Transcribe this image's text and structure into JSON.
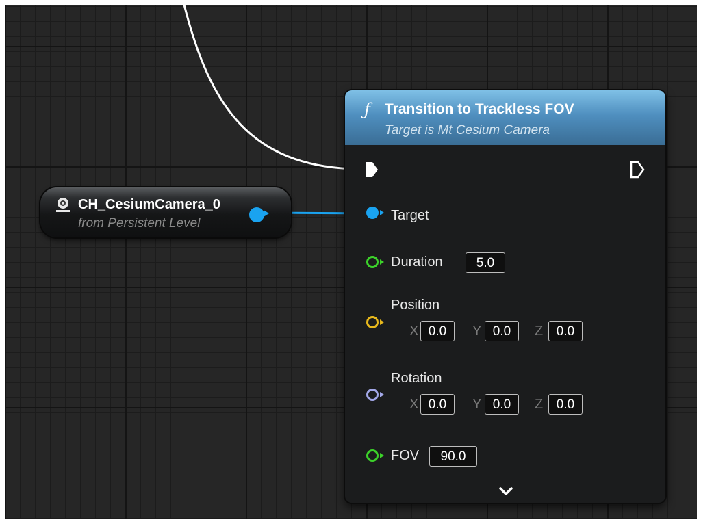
{
  "reference_node": {
    "name": "CH_CesiumCamera_0",
    "source": "from Persistent Level",
    "icon": "camera-actor-icon"
  },
  "function_node": {
    "icon_glyph": "ƒ",
    "title": "Transition to Trackless FOV",
    "subtitle": "Target is Mt Cesium Camera",
    "target_label": "Target",
    "duration": {
      "label": "Duration",
      "value": "5.0"
    },
    "position": {
      "label": "Position",
      "x_label": "X",
      "x": "0.0",
      "y_label": "Y",
      "y": "0.0",
      "z_label": "Z",
      "z": "0.0"
    },
    "rotation": {
      "label": "Rotation",
      "x_label": "X",
      "x": "0.0",
      "y_label": "Y",
      "y": "0.0",
      "z_label": "Z",
      "z": "0.0"
    },
    "fov": {
      "label": "FOV",
      "value": "90.0"
    },
    "expand_icon": "chevron-down-icon"
  },
  "colors": {
    "exec_wire": "#ffffff",
    "object_pin": "#1aa3f0",
    "float_pin": "#3cd12a",
    "vector_pin": "#e8b81c",
    "rotator_pin": "#a3a8e8",
    "header_blue": "#4f8fbf"
  }
}
